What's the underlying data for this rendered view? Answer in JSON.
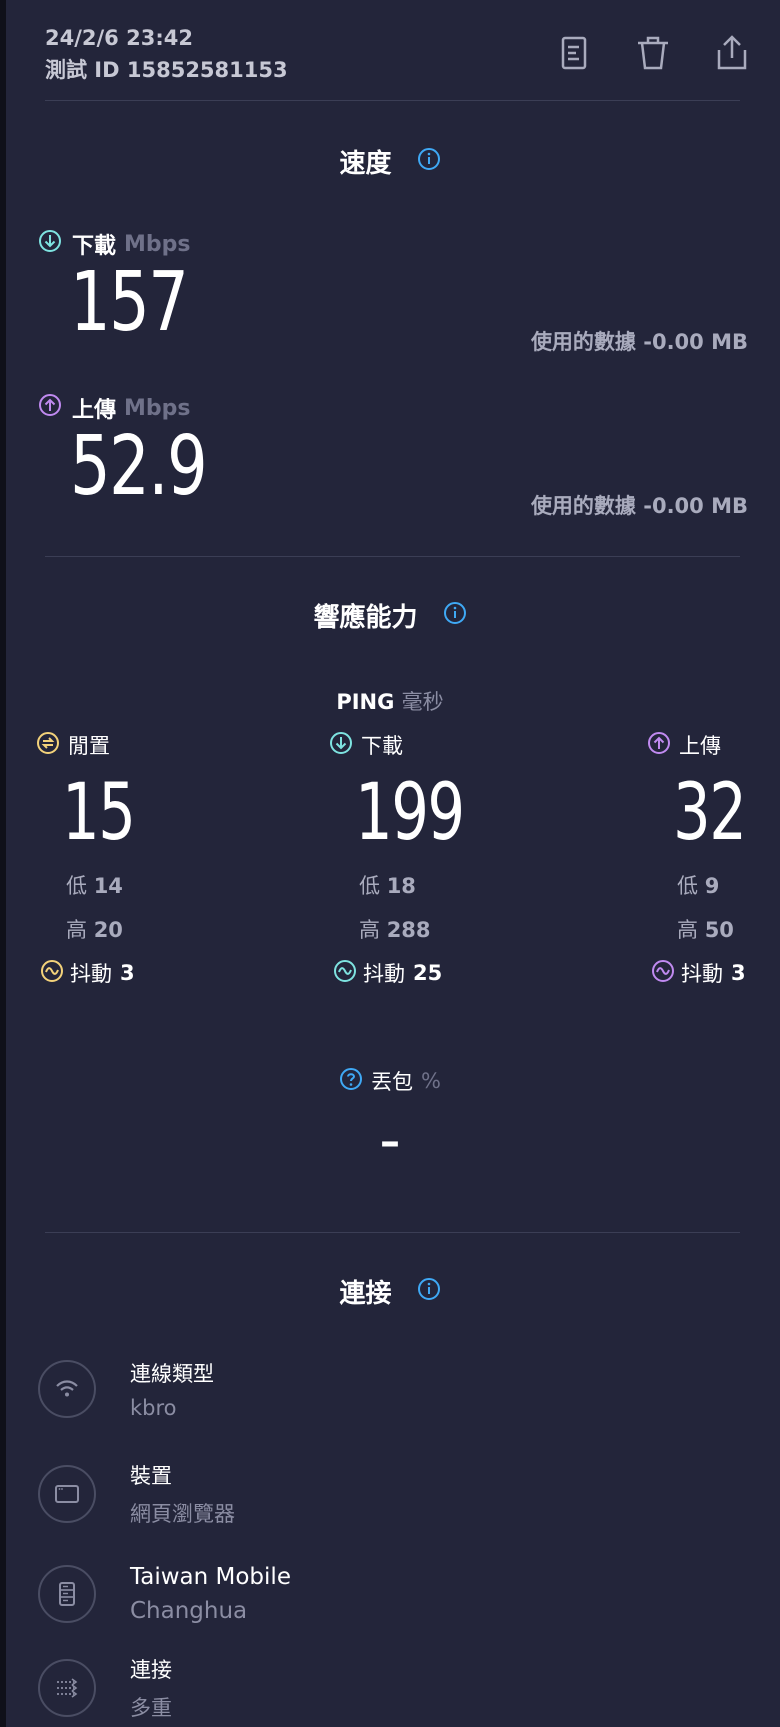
{
  "header": {
    "date": "24/2/6 23:42",
    "test_id": "測試 ID 15852581153",
    "icons": [
      "document-icon",
      "trash-icon",
      "share-icon"
    ]
  },
  "speed": {
    "title": "速度",
    "download": {
      "label": "下載",
      "unit": "Mbps",
      "value": "157",
      "data_used": "使用的數據 -0.00 MB"
    },
    "upload": {
      "label": "上傳",
      "unit": "Mbps",
      "value": "52.9",
      "data_used": "使用的數據 -0.00 MB"
    }
  },
  "responsiveness": {
    "title": "響應能力",
    "ping_label": "PING",
    "ping_unit": "毫秒",
    "columns": [
      {
        "label": "閒置",
        "value": "15",
        "low_label": "低",
        "low": "14",
        "high_label": "高",
        "high": "20",
        "jitter_label": "抖動",
        "jitter": "3",
        "color": "#f3d27a"
      },
      {
        "label": "下載",
        "value": "199",
        "low_label": "低",
        "low": "18",
        "high_label": "高",
        "high": "288",
        "jitter_label": "抖動",
        "jitter": "25",
        "color": "#7ee3e0"
      },
      {
        "label": "上傳",
        "value": "32",
        "low_label": "低",
        "low": "9",
        "high_label": "高",
        "high": "50",
        "jitter_label": "抖動",
        "jitter": "3",
        "color": "#c08af0"
      }
    ]
  },
  "packet_loss": {
    "label": "丟包",
    "unit": "%",
    "value": "–"
  },
  "connection": {
    "title": "連接",
    "rows": [
      {
        "title": "連線類型",
        "value": "kbro",
        "icon": "wifi-icon"
      },
      {
        "title": "裝置",
        "value": "網頁瀏覽器",
        "icon": "browser-icon"
      },
      {
        "title": "Taiwan Mobile",
        "value": "Changhua",
        "icon": "server-icon"
      },
      {
        "title": "連接",
        "value": "多重",
        "icon": "multi-connection-icon"
      }
    ]
  },
  "colors": {
    "background": "#23253a",
    "info_blue": "#3fa9f5",
    "download_cyan": "#7ee3e0",
    "upload_purple": "#c08af0",
    "idle_yellow": "#f3d27a"
  }
}
